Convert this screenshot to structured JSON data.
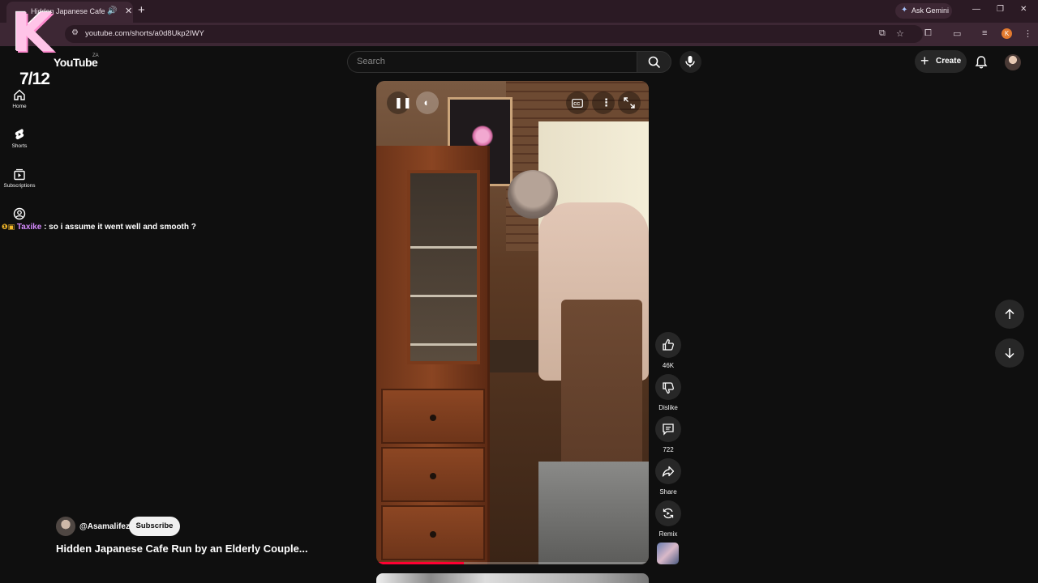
{
  "browser": {
    "tab_title": "Hidden Japanese Cafe Run",
    "new_tab_symbol": "+",
    "gemini_label": "Ask Gemini",
    "url": "youtube.com/shorts/a0d8Ukp2IWY",
    "profile_initial": "K"
  },
  "overlay": {
    "badge_letter": "K",
    "counter": "7/12"
  },
  "youtube": {
    "logo_text": "YouTube",
    "region": "ZA",
    "search_placeholder": "Search",
    "create_label": "Create"
  },
  "sidebar": {
    "items": [
      {
        "label": "Home",
        "icon": "home-icon"
      },
      {
        "label": "Shorts",
        "icon": "shorts-icon"
      },
      {
        "label": "Subscriptions",
        "icon": "subscriptions-icon"
      },
      {
        "label": "You",
        "icon": "account-icon"
      }
    ]
  },
  "chat": {
    "user": "Taxike",
    "message": ": so i assume it went well and smooth ?"
  },
  "video": {
    "progress_fraction": 0.32
  },
  "actions": {
    "like_count": "46K",
    "dislike_label": "Dislike",
    "comment_count": "722",
    "share_label": "Share",
    "remix_label": "Remix"
  },
  "channel": {
    "handle": "@Asamalifez",
    "subscribe_label": "Subscribe",
    "title": "Hidden Japanese Cafe Run by an Elderly Couple..."
  },
  "colors": {
    "accent": "#ff0033",
    "chrome_bg": "#2b1a24",
    "page_bg": "#0f0f0f"
  }
}
